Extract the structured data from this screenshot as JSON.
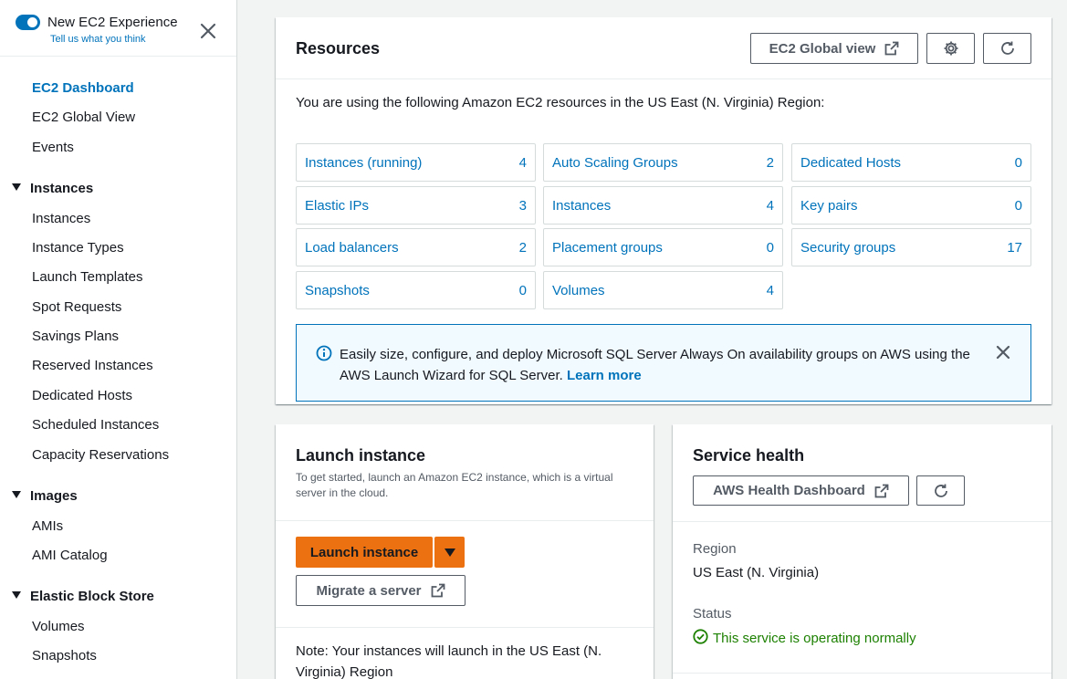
{
  "experience": {
    "title": "New EC2 Experience",
    "feedback_link": "Tell us what you think"
  },
  "nav": {
    "top_items": [
      "EC2 Dashboard",
      "EC2 Global View",
      "Events"
    ],
    "sections": [
      {
        "title": "Instances",
        "items": [
          "Instances",
          "Instance Types",
          "Launch Templates",
          "Spot Requests",
          "Savings Plans",
          "Reserved Instances",
          "Dedicated Hosts",
          "Scheduled Instances",
          "Capacity Reservations"
        ]
      },
      {
        "title": "Images",
        "items": [
          "AMIs",
          "AMI Catalog"
        ]
      },
      {
        "title": "Elastic Block Store",
        "items": [
          "Volumes",
          "Snapshots"
        ]
      }
    ]
  },
  "resources": {
    "title": "Resources",
    "global_view_button": "EC2 Global view",
    "intro": "You are using the following Amazon EC2 resources in the US East (N. Virginia) Region:",
    "items": [
      {
        "name": "Instances (running)",
        "count": "4"
      },
      {
        "name": "Auto Scaling Groups",
        "count": "2"
      },
      {
        "name": "Dedicated Hosts",
        "count": "0"
      },
      {
        "name": "Elastic IPs",
        "count": "3"
      },
      {
        "name": "Instances",
        "count": "4"
      },
      {
        "name": "Key pairs",
        "count": "0"
      },
      {
        "name": "Load balancers",
        "count": "2"
      },
      {
        "name": "Placement groups",
        "count": "0"
      },
      {
        "name": "Security groups",
        "count": "17"
      },
      {
        "name": "Snapshots",
        "count": "0"
      },
      {
        "name": "Volumes",
        "count": "4"
      }
    ],
    "info_text": "Easily size, configure, and deploy Microsoft SQL Server Always On availability groups on AWS using the AWS Launch Wizard for SQL Server.",
    "info_link": "Learn more"
  },
  "launch": {
    "title": "Launch instance",
    "description": "To get started, launch an Amazon EC2 instance, which is a virtual server in the cloud.",
    "launch_button": "Launch instance",
    "migrate_button": "Migrate a server",
    "note": "Note: Your instances will launch in the US East (N. Virginia) Region"
  },
  "health": {
    "title": "Service health",
    "dashboard_button": "AWS Health Dashboard",
    "region_label": "Region",
    "region_value": "US East (N. Virginia)",
    "status_label": "Status",
    "status_value": "This service is operating normally"
  },
  "colors": {
    "link": "#0073bb",
    "primary_button": "#ec7211",
    "success": "#1d8102"
  }
}
